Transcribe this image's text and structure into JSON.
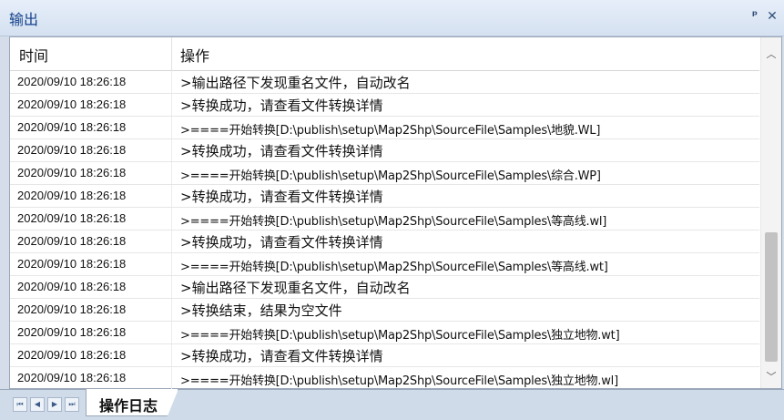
{
  "panel": {
    "title": "输出",
    "pin_icon": "pin-icon",
    "close_icon": "close-icon",
    "pin_glyph": "ᵖ",
    "close_glyph": "✕"
  },
  "table": {
    "columns": [
      "时间",
      "操作"
    ],
    "rows": [
      {
        "time": "2020/09/10 18:26:18",
        "op": ">输出路径下发现重名文件，自动改名"
      },
      {
        "time": "2020/09/10 18:26:18",
        "op": ">转换成功，请查看文件转换详情"
      },
      {
        "time": "2020/09/10 18:26:18",
        "op": ">====开始转换[D:\\publish\\setup\\Map2Shp\\SourceFile\\Samples\\地貌.WL]"
      },
      {
        "time": "2020/09/10 18:26:18",
        "op": ">转换成功，请查看文件转换详情"
      },
      {
        "time": "2020/09/10 18:26:18",
        "op": ">====开始转换[D:\\publish\\setup\\Map2Shp\\SourceFile\\Samples\\综合.WP]"
      },
      {
        "time": "2020/09/10 18:26:18",
        "op": ">转换成功，请查看文件转换详情"
      },
      {
        "time": "2020/09/10 18:26:18",
        "op": ">====开始转换[D:\\publish\\setup\\Map2Shp\\SourceFile\\Samples\\等高线.wl]"
      },
      {
        "time": "2020/09/10 18:26:18",
        "op": ">转换成功，请查看文件转换详情"
      },
      {
        "time": "2020/09/10 18:26:18",
        "op": ">====开始转换[D:\\publish\\setup\\Map2Shp\\SourceFile\\Samples\\等高线.wt]"
      },
      {
        "time": "2020/09/10 18:26:18",
        "op": ">输出路径下发现重名文件，自动改名"
      },
      {
        "time": "2020/09/10 18:26:18",
        "op": ">转换结束，结果为空文件"
      },
      {
        "time": "2020/09/10 18:26:18",
        "op": ">====开始转换[D:\\publish\\setup\\Map2Shp\\SourceFile\\Samples\\独立地物.wt]"
      },
      {
        "time": "2020/09/10 18:26:18",
        "op": ">转换成功，请查看文件转换详情"
      },
      {
        "time": "2020/09/10 18:26:18",
        "op": ">====开始转换[D:\\publish\\setup\\Map2Shp\\SourceFile\\Samples\\独立地物.wl]"
      }
    ]
  },
  "scrollbar": {
    "up_icon": "chevron-up-icon",
    "down_icon": "chevron-down-icon",
    "up_glyph": "︿",
    "down_glyph": "﹀"
  },
  "tabs": {
    "nav": [
      {
        "icon": "first-page-icon",
        "glyph": "⏮"
      },
      {
        "icon": "prev-icon",
        "glyph": "◀"
      },
      {
        "icon": "next-icon",
        "glyph": "▶"
      },
      {
        "icon": "last-page-icon",
        "glyph": "⏭"
      }
    ],
    "active_label": "操作日志"
  },
  "colors": {
    "title_text": "#15428b",
    "panel_background": "#d4dde9",
    "scroll_thumb": "#c2c2c2"
  }
}
